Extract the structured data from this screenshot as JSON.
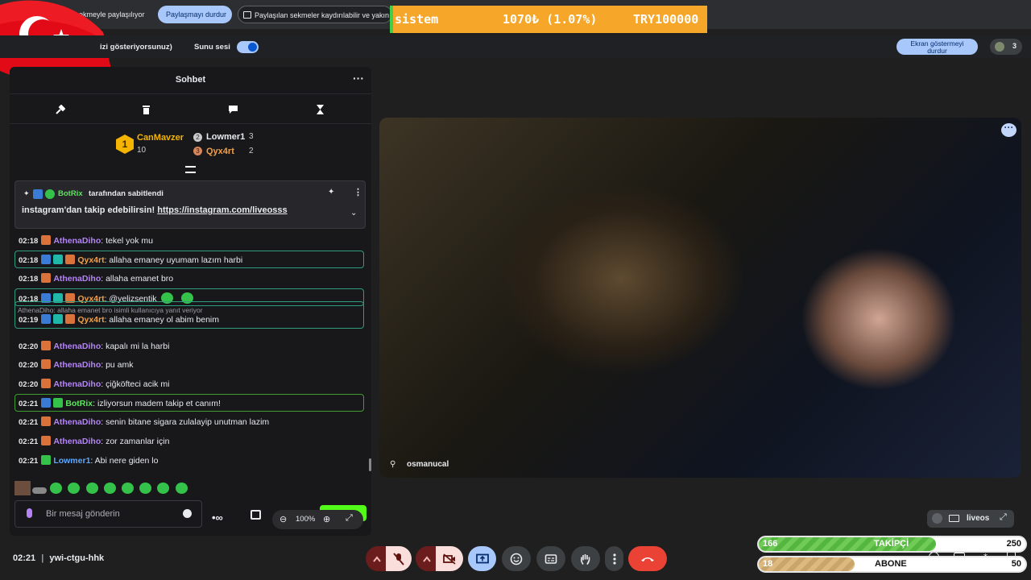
{
  "sharebar": {
    "share_this_tab": "Bu sekmeyle paylaşılıyor",
    "stop_sharing": "Paylaşmayı durdur",
    "saved_tabs": "Paylaşılan sekmeler kaydırılabilir ve yakını"
  },
  "ticker": {
    "name": "sistem",
    "value": "1070₺ (1.07%)",
    "goal": "TRY100000"
  },
  "meetbar": {
    "presenting_note": "izi gösteriyorsunuz)",
    "presentation_audio": "Sunu sesi",
    "stop_showing": "Ekran göstermeyi durdur",
    "participants": "3"
  },
  "chat": {
    "title": "Sohbet",
    "leaderboard": {
      "first": {
        "name": "CanMavzer",
        "rank": "1",
        "count": "10"
      },
      "second": {
        "name": "Lowmer1",
        "rank": "2",
        "count": "3"
      },
      "third": {
        "name": "Qyx4rt",
        "rank": "3",
        "count": "2"
      }
    },
    "pinned": {
      "by": "BotRix",
      "pinned_label": "tarafından sabitlendi",
      "text": "instagram'dan takip edebilirsin! ",
      "link": "https://instagram.com/liveosss"
    },
    "messages": [
      {
        "time": "02:18",
        "user": "AthenaDiho",
        "text": ": tekel yok mu"
      },
      {
        "time": "02:18",
        "user": "Qyx4rt",
        "text": ": allaha emaney uyumam lazım harbi"
      },
      {
        "time": "02:18",
        "user": "AthenaDiho",
        "text": ": allaha emanet bro"
      },
      {
        "time": "02:18",
        "user": "Qyx4rt",
        "text": ": @yelizsentik"
      },
      {
        "time": "02:19",
        "user": "Qyx4rt",
        "text": ": allaha emaney ol abim benim",
        "reply": "AthenaDiho: allaha emanet bro isimli kullanıcıya yanıt veriyor"
      },
      {
        "time": "02:20",
        "user": "AthenaDiho",
        "text": ": kapalı mi la harbi"
      },
      {
        "time": "02:20",
        "user": "AthenaDiho",
        "text": ": pu amk"
      },
      {
        "time": "02:20",
        "user": "AthenaDiho",
        "text": ": çiğköfteci acik mi"
      },
      {
        "time": "02:21",
        "user": "BotRix",
        "text": ": izliyorsun madem takip et canım!"
      },
      {
        "time": "02:21",
        "user": "AthenaDiho",
        "text": ": senin bitane sigara zulalayip unutman lazim"
      },
      {
        "time": "02:21",
        "user": "AthenaDiho",
        "text": ": zor zamanlar için"
      },
      {
        "time": "02:21",
        "user": "Lowmer1",
        "text": ": Abi nere giden lo"
      }
    ],
    "input_placeholder": "Bir mesaj gönderin",
    "zoom": "100%"
  },
  "video": {
    "participant": "osmanucal",
    "self_label": "liveos"
  },
  "bottom": {
    "time": "02:21",
    "meeting_code": "ywi-ctgu-hhk"
  },
  "goals": {
    "followers": {
      "label": "TAKİPÇİ",
      "current": "166",
      "target": "250",
      "progress": 0.664
    },
    "subs": {
      "label": "ABONE",
      "current": "18",
      "target": "50",
      "progress": 0.36
    }
  },
  "colors": {
    "accent_green": "#53fc18",
    "user_purple": "#b484f6",
    "user_orange": "#f0a04b",
    "user_blue": "#5aa9ff",
    "botrix_green": "#5ce65c",
    "end_call_red": "#ea4335"
  }
}
